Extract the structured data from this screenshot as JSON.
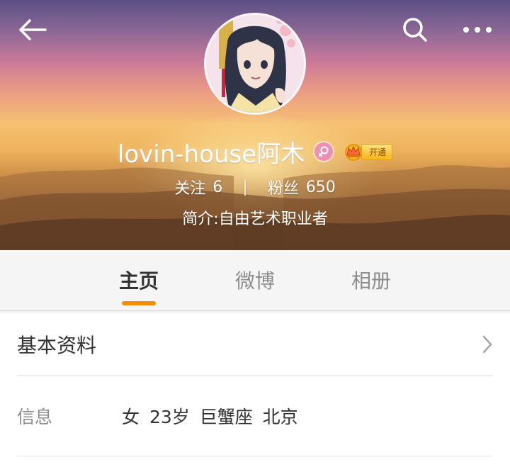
{
  "header": {
    "profile_name": "lovin-house阿木",
    "vip_label": "开通",
    "stats": {
      "following_label": "关注",
      "following_count": "6",
      "separator": "|",
      "followers_label": "粉丝",
      "followers_count": "650"
    },
    "bio": "简介:自由艺术职业者",
    "icons": {
      "back": "back-arrow-icon",
      "search": "search-icon",
      "more": "more-dots-icon",
      "gender": "female-icon",
      "vip": "crown-icon"
    }
  },
  "tabs": [
    {
      "label": "主页",
      "active": true
    },
    {
      "label": "微博",
      "active": false
    },
    {
      "label": "相册",
      "active": false
    }
  ],
  "basic_info": {
    "title": "基本资料",
    "info_label": "信息",
    "info_value": "女 23岁 巨蟹座 北京"
  },
  "colors": {
    "accent": "#f28c00",
    "female_badge": "#ee8fb8",
    "vip_gold": "#f5b51e",
    "text_primary": "#333333",
    "text_secondary": "#8c8c8c"
  }
}
